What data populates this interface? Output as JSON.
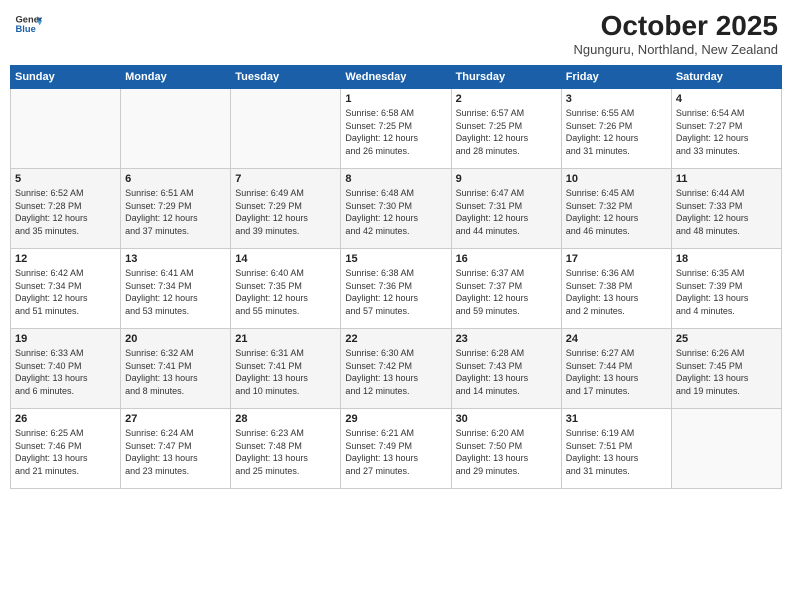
{
  "header": {
    "logo_line1": "General",
    "logo_line2": "Blue",
    "month": "October 2025",
    "location": "Ngunguru, Northland, New Zealand"
  },
  "days_of_week": [
    "Sunday",
    "Monday",
    "Tuesday",
    "Wednesday",
    "Thursday",
    "Friday",
    "Saturday"
  ],
  "weeks": [
    [
      {
        "day": "",
        "info": ""
      },
      {
        "day": "",
        "info": ""
      },
      {
        "day": "",
        "info": ""
      },
      {
        "day": "1",
        "info": "Sunrise: 6:58 AM\nSunset: 7:25 PM\nDaylight: 12 hours\nand 26 minutes."
      },
      {
        "day": "2",
        "info": "Sunrise: 6:57 AM\nSunset: 7:25 PM\nDaylight: 12 hours\nand 28 minutes."
      },
      {
        "day": "3",
        "info": "Sunrise: 6:55 AM\nSunset: 7:26 PM\nDaylight: 12 hours\nand 31 minutes."
      },
      {
        "day": "4",
        "info": "Sunrise: 6:54 AM\nSunset: 7:27 PM\nDaylight: 12 hours\nand 33 minutes."
      }
    ],
    [
      {
        "day": "5",
        "info": "Sunrise: 6:52 AM\nSunset: 7:28 PM\nDaylight: 12 hours\nand 35 minutes."
      },
      {
        "day": "6",
        "info": "Sunrise: 6:51 AM\nSunset: 7:29 PM\nDaylight: 12 hours\nand 37 minutes."
      },
      {
        "day": "7",
        "info": "Sunrise: 6:49 AM\nSunset: 7:29 PM\nDaylight: 12 hours\nand 39 minutes."
      },
      {
        "day": "8",
        "info": "Sunrise: 6:48 AM\nSunset: 7:30 PM\nDaylight: 12 hours\nand 42 minutes."
      },
      {
        "day": "9",
        "info": "Sunrise: 6:47 AM\nSunset: 7:31 PM\nDaylight: 12 hours\nand 44 minutes."
      },
      {
        "day": "10",
        "info": "Sunrise: 6:45 AM\nSunset: 7:32 PM\nDaylight: 12 hours\nand 46 minutes."
      },
      {
        "day": "11",
        "info": "Sunrise: 6:44 AM\nSunset: 7:33 PM\nDaylight: 12 hours\nand 48 minutes."
      }
    ],
    [
      {
        "day": "12",
        "info": "Sunrise: 6:42 AM\nSunset: 7:34 PM\nDaylight: 12 hours\nand 51 minutes."
      },
      {
        "day": "13",
        "info": "Sunrise: 6:41 AM\nSunset: 7:34 PM\nDaylight: 12 hours\nand 53 minutes."
      },
      {
        "day": "14",
        "info": "Sunrise: 6:40 AM\nSunset: 7:35 PM\nDaylight: 12 hours\nand 55 minutes."
      },
      {
        "day": "15",
        "info": "Sunrise: 6:38 AM\nSunset: 7:36 PM\nDaylight: 12 hours\nand 57 minutes."
      },
      {
        "day": "16",
        "info": "Sunrise: 6:37 AM\nSunset: 7:37 PM\nDaylight: 12 hours\nand 59 minutes."
      },
      {
        "day": "17",
        "info": "Sunrise: 6:36 AM\nSunset: 7:38 PM\nDaylight: 13 hours\nand 2 minutes."
      },
      {
        "day": "18",
        "info": "Sunrise: 6:35 AM\nSunset: 7:39 PM\nDaylight: 13 hours\nand 4 minutes."
      }
    ],
    [
      {
        "day": "19",
        "info": "Sunrise: 6:33 AM\nSunset: 7:40 PM\nDaylight: 13 hours\nand 6 minutes."
      },
      {
        "day": "20",
        "info": "Sunrise: 6:32 AM\nSunset: 7:41 PM\nDaylight: 13 hours\nand 8 minutes."
      },
      {
        "day": "21",
        "info": "Sunrise: 6:31 AM\nSunset: 7:41 PM\nDaylight: 13 hours\nand 10 minutes."
      },
      {
        "day": "22",
        "info": "Sunrise: 6:30 AM\nSunset: 7:42 PM\nDaylight: 13 hours\nand 12 minutes."
      },
      {
        "day": "23",
        "info": "Sunrise: 6:28 AM\nSunset: 7:43 PM\nDaylight: 13 hours\nand 14 minutes."
      },
      {
        "day": "24",
        "info": "Sunrise: 6:27 AM\nSunset: 7:44 PM\nDaylight: 13 hours\nand 17 minutes."
      },
      {
        "day": "25",
        "info": "Sunrise: 6:26 AM\nSunset: 7:45 PM\nDaylight: 13 hours\nand 19 minutes."
      }
    ],
    [
      {
        "day": "26",
        "info": "Sunrise: 6:25 AM\nSunset: 7:46 PM\nDaylight: 13 hours\nand 21 minutes."
      },
      {
        "day": "27",
        "info": "Sunrise: 6:24 AM\nSunset: 7:47 PM\nDaylight: 13 hours\nand 23 minutes."
      },
      {
        "day": "28",
        "info": "Sunrise: 6:23 AM\nSunset: 7:48 PM\nDaylight: 13 hours\nand 25 minutes."
      },
      {
        "day": "29",
        "info": "Sunrise: 6:21 AM\nSunset: 7:49 PM\nDaylight: 13 hours\nand 27 minutes."
      },
      {
        "day": "30",
        "info": "Sunrise: 6:20 AM\nSunset: 7:50 PM\nDaylight: 13 hours\nand 29 minutes."
      },
      {
        "day": "31",
        "info": "Sunrise: 6:19 AM\nSunset: 7:51 PM\nDaylight: 13 hours\nand 31 minutes."
      },
      {
        "day": "",
        "info": ""
      }
    ]
  ]
}
